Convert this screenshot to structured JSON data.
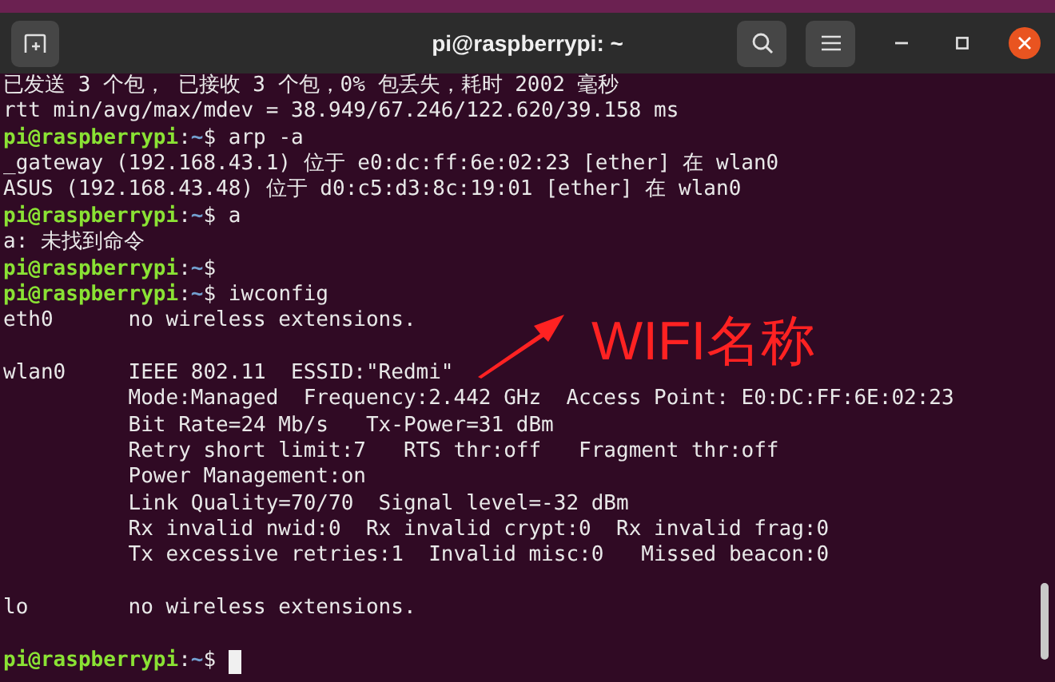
{
  "window": {
    "title": "pi@raspberrypi: ~"
  },
  "terminal": {
    "lines": [
      {
        "kind": "output",
        "text": "已发送 3 个包， 已接收 3 个包，0% 包丢失，耗时 2002 毫秒"
      },
      {
        "kind": "output",
        "text": "rtt min/avg/max/mdev = 38.949/67.246/122.620/39.158 ms"
      },
      {
        "kind": "prompt",
        "user_host": "pi@raspberrypi",
        "separator": ":",
        "path": "~",
        "symbol": "$",
        "command": "arp -a"
      },
      {
        "kind": "output",
        "text": "_gateway (192.168.43.1) 位于 e0:dc:ff:6e:02:23 [ether] 在 wlan0"
      },
      {
        "kind": "output",
        "text": "ASUS (192.168.43.48) 位于 d0:c5:d3:8c:19:01 [ether] 在 wlan0"
      },
      {
        "kind": "prompt",
        "user_host": "pi@raspberrypi",
        "separator": ":",
        "path": "~",
        "symbol": "$",
        "command": "a"
      },
      {
        "kind": "output",
        "text": "a: 未找到命令"
      },
      {
        "kind": "prompt",
        "user_host": "pi@raspberrypi",
        "separator": ":",
        "path": "~",
        "symbol": "$"
      },
      {
        "kind": "prompt",
        "user_host": "pi@raspberrypi",
        "separator": ":",
        "path": "~",
        "symbol": "$",
        "command": "iwconfig"
      },
      {
        "kind": "output",
        "text": "eth0      no wireless extensions."
      },
      {
        "kind": "blank"
      },
      {
        "kind": "output",
        "text": "wlan0     IEEE 802.11  ESSID:\"Redmi\""
      },
      {
        "kind": "output",
        "text": "          Mode:Managed  Frequency:2.442 GHz  Access Point: E0:DC:FF:6E:02:23"
      },
      {
        "kind": "output",
        "text": "          Bit Rate=24 Mb/s   Tx-Power=31 dBm"
      },
      {
        "kind": "output",
        "text": "          Retry short limit:7   RTS thr:off   Fragment thr:off"
      },
      {
        "kind": "output",
        "text": "          Power Management:on"
      },
      {
        "kind": "output",
        "text": "          Link Quality=70/70  Signal level=-32 dBm"
      },
      {
        "kind": "output",
        "text": "          Rx invalid nwid:0  Rx invalid crypt:0  Rx invalid frag:0"
      },
      {
        "kind": "output",
        "text": "          Tx excessive retries:1  Invalid misc:0   Missed beacon:0"
      },
      {
        "kind": "blank"
      },
      {
        "kind": "output",
        "text": "lo        no wireless extensions."
      },
      {
        "kind": "blank"
      },
      {
        "kind": "prompt",
        "user_host": "pi@raspberrypi",
        "separator": ":",
        "path": "~",
        "symbol": "$",
        "cursor": true
      }
    ]
  },
  "annotation": {
    "text": "WIFI名称"
  }
}
